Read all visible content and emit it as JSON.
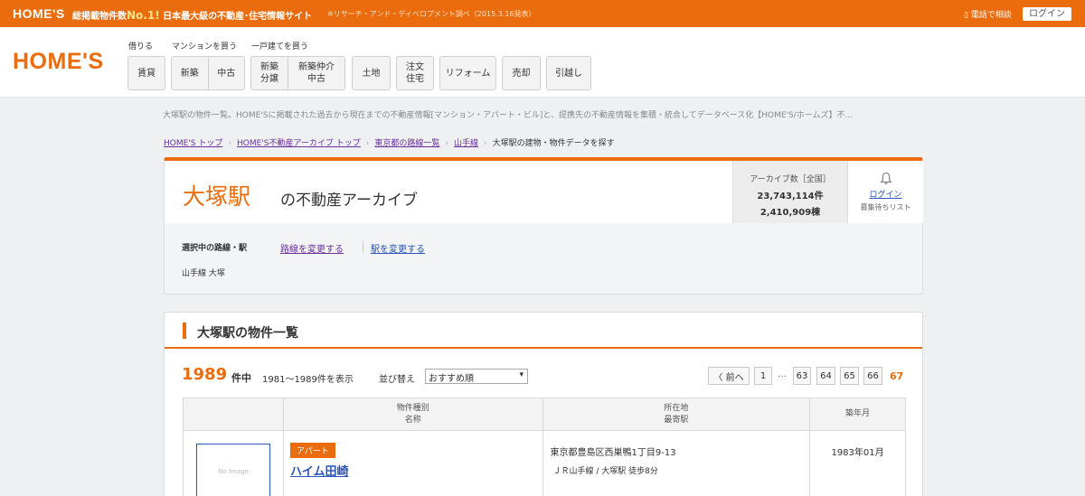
{
  "topbar": {
    "brand": "HOME'S",
    "slogan_prefix": "総掲載物件数",
    "slogan_no1": "No.1!",
    "slogan_main": "日本最大級の不動産･住宅情報サイト",
    "source_note": "※リサーチ・アンド・ディベロプメント調べ（2015.3.16発表）",
    "phone": "電話で相談",
    "login": "ログイン"
  },
  "header": {
    "logo": "HOME'S",
    "groups": {
      "rent": "借りる",
      "mansion": "マンションを買う",
      "house": "一戸建てを買う"
    },
    "nav": {
      "chintai": "賃貸",
      "shinchiku": "新築",
      "chuko": "中古",
      "shinchiku_bunjo": "新築\n分譲",
      "shinchiku_chukai": "新築仲介\n中古",
      "tochi": "土地",
      "chumon": "注文\n住宅",
      "reform": "リフォーム",
      "baikyaku": "売却",
      "hikkoshi": "引越し"
    }
  },
  "description": "大塚駅の物件一覧。HOME'Sに掲載された過去から現在までの不動産情報[マンション・アパート・ビル]と、提携先の不動産情報を集積・統合してデータベース化【HOME'S/ホームズ】不...",
  "breadcrumb": [
    "HOME'S トップ",
    "HOME'S不動産アーカイブ トップ",
    "東京都の路線一覧",
    "山手線",
    "大塚駅の建物・物件データを探す"
  ],
  "archive": {
    "station": "大塚駅",
    "suffix": "の不動産アーカイブ",
    "count_label": "アーカイブ数［全国］",
    "count1": "23,743,114件",
    "count2": "2,410,909棟",
    "login": "ログイン",
    "wishlist": "募集待ちリスト",
    "selected_label": "選択中の路線・駅",
    "change_line": "路線を変更する",
    "change_station": "駅を変更する",
    "current": "山手線 大塚"
  },
  "listing": {
    "title": "大塚駅の物件一覧",
    "total": "1989",
    "total_unit": "件中",
    "range": "1981～1989件を表示",
    "sort_label": "並び替え",
    "sort_value": "おすすめ順",
    "pagination": {
      "prev": "〈 前へ",
      "first": "1",
      "dots": "…",
      "pages": [
        "63",
        "64",
        "65",
        "66"
      ],
      "current": "67"
    },
    "headers": {
      "type": "物件種別",
      "name": "名称",
      "location": "所在地",
      "station": "最寄駅",
      "built": "築年月"
    },
    "rows": [
      {
        "image_text": "No Image",
        "type": "アパート",
        "name": "ハイム田崎",
        "address": "東京都豊島区西巣鴨1丁目9-13",
        "station": "ＪＲ山手線 / 大塚駅 徒歩8分",
        "built": "1983年01月"
      }
    ]
  },
  "colors": {
    "accent": "#ea6c0d",
    "link": "#2a54b8",
    "visited": "#6b2fa0"
  }
}
